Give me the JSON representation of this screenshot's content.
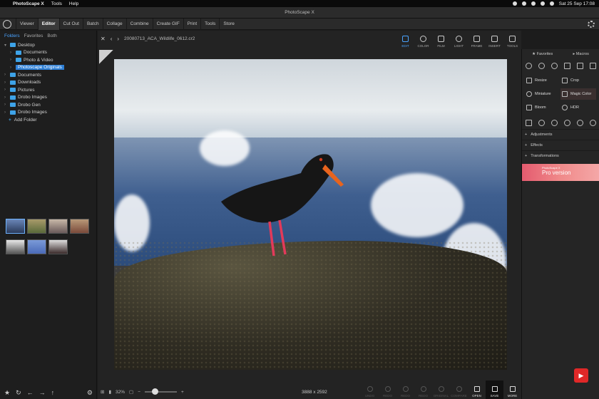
{
  "menubar": {
    "app_name": "PhotoScape X",
    "items": [
      "Tools",
      "Help"
    ],
    "clock": "Sat 25 Sep  17:08"
  },
  "window": {
    "title": "PhotoScape X"
  },
  "nav": {
    "tabs": [
      "Viewer",
      "Editor",
      "Cut Out",
      "Batch",
      "Collage",
      "Combine",
      "Create GIF",
      "Print",
      "Tools",
      "Store"
    ],
    "active": "Editor"
  },
  "left": {
    "tabs": [
      "Folders",
      "Favorites",
      "Both"
    ],
    "tree": [
      {
        "label": "Desktop",
        "indent": 0,
        "expanded": true
      },
      {
        "label": "Documents",
        "indent": 1
      },
      {
        "label": "Photo & Video",
        "indent": 1
      },
      {
        "label": "Photoscape Originals",
        "indent": 1,
        "selected": true
      },
      {
        "label": "Documents",
        "indent": 0
      },
      {
        "label": "Downloads",
        "indent": 0
      },
      {
        "label": "Pictures",
        "indent": 0
      },
      {
        "label": "Drobo Images",
        "indent": 0
      },
      {
        "label": "Drobo Gen",
        "indent": 0
      },
      {
        "label": "Drobo Images",
        "indent": 0
      }
    ],
    "add_folder": "Add Folder"
  },
  "center": {
    "filename": "20080713_ACA_Wildlife_0612.cr2",
    "zoom": "32%",
    "dimensions": "3888 x 2592",
    "edit_tools": [
      "EDIT",
      "COLOR",
      "FILM",
      "LIGHT",
      "FRAME",
      "INSERT",
      "TOOLS"
    ],
    "actions": [
      "UNDO",
      "REDO",
      "REDO",
      "REDO",
      "ORIGINAL",
      "COMPARE",
      "OPEN",
      "SAVE",
      "MORE"
    ]
  },
  "right": {
    "tabs": [
      "Favorites",
      "Macros"
    ],
    "tools": [
      "Resize",
      "Crop",
      "Miniature",
      "Magic Color",
      "Bloom",
      "HDR"
    ],
    "sections": [
      "Adjustments",
      "Effects",
      "Transformations"
    ],
    "promo": "Pro version",
    "promo_small": "PhotoScape X"
  },
  "colors": {
    "accent": "#4aa3ff",
    "selection": "#2d7fd6",
    "promo": "#e45b6f"
  }
}
